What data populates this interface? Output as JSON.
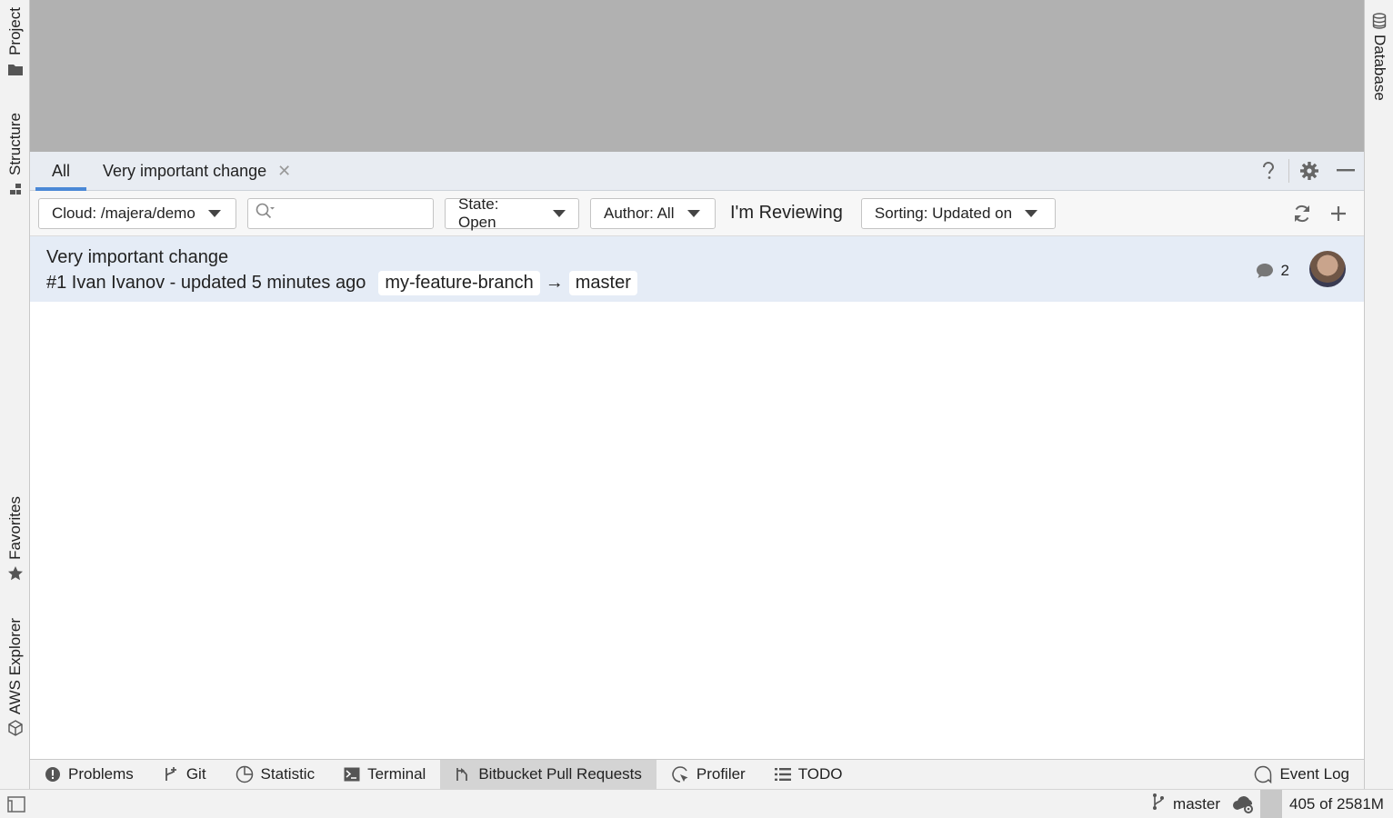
{
  "left_strip": {
    "project": "Project",
    "structure": "Structure",
    "favorites": "Favorites",
    "aws_explorer": "AWS Explorer"
  },
  "right_strip": {
    "database": "Database"
  },
  "tool_window": {
    "tabs": [
      {
        "label": "All",
        "active": true
      },
      {
        "label": "Very important change",
        "closable": true
      }
    ],
    "actions": [
      "help-icon",
      "gear-icon",
      "minimize-icon"
    ]
  },
  "filters": {
    "repository": "Cloud: /majera/demo",
    "search_placeholder": "",
    "state": "State: Open",
    "author": "Author: All",
    "reviewing": "I'm Reviewing",
    "sorting": "Sorting: Updated on"
  },
  "pull_requests": [
    {
      "title": "Very important change",
      "meta": "#1 Ivan Ivanov - updated 5 minutes ago",
      "source_branch": "my-feature-branch",
      "target_branch": "master",
      "arrow": "→",
      "comments": "2"
    }
  ],
  "bottom_tabs": [
    {
      "label": "Problems",
      "icon": "problems-icon"
    },
    {
      "label": "Git",
      "icon": "git-icon"
    },
    {
      "label": "Statistic",
      "icon": "statistic-icon"
    },
    {
      "label": "Terminal",
      "icon": "terminal-icon"
    },
    {
      "label": "Bitbucket Pull Requests",
      "icon": "bitbucket-icon",
      "active": true
    },
    {
      "label": "Profiler",
      "icon": "profiler-icon"
    },
    {
      "label": "TODO",
      "icon": "todo-icon"
    }
  ],
  "event_log": "Event Log",
  "status_bar": {
    "branch": "master",
    "memory": "405 of 2581M"
  },
  "colors": {
    "accent": "#4a88d6",
    "selected_row": "#e5ecf6",
    "editor_bg": "#b1b1b1"
  }
}
